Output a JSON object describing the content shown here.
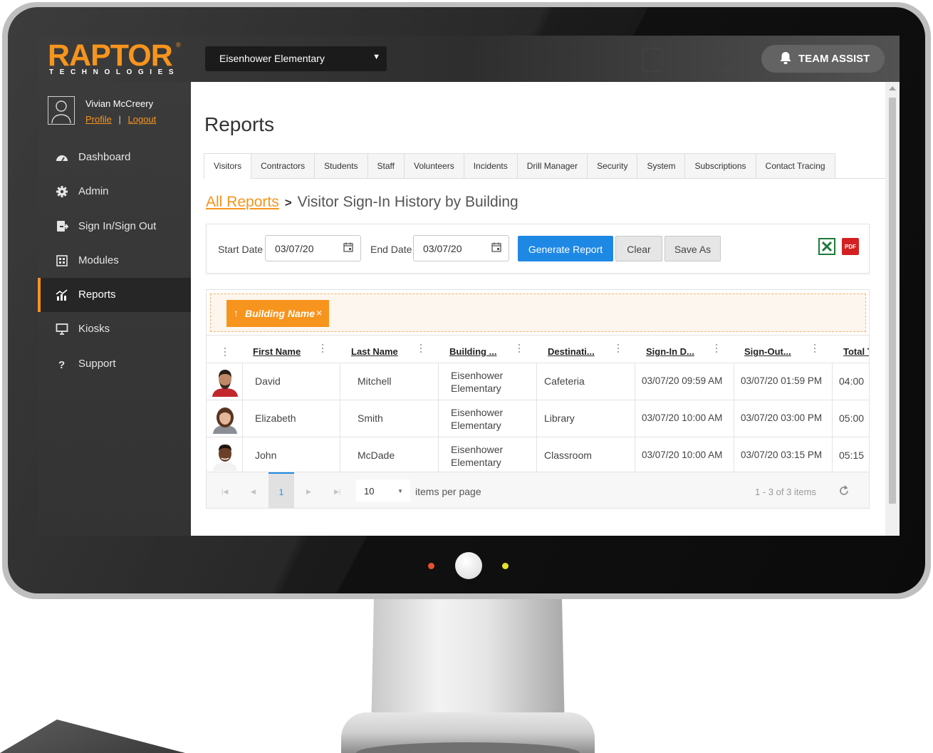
{
  "header": {
    "logo_main": "RAPTOR",
    "logo_sub": "TECHNOLOGIES",
    "school": "Eisenhower Elementary",
    "team_assist": "TEAM ASSIST"
  },
  "user": {
    "name": "Vivian McCreery",
    "profile_link": "Profile",
    "logout_link": "Logout",
    "separator": "|"
  },
  "sidebar": {
    "items": [
      {
        "label": "Dashboard",
        "icon": "dashboard-icon"
      },
      {
        "label": "Admin",
        "icon": "gear-icon"
      },
      {
        "label": "Sign In/Sign Out",
        "icon": "sign-in-icon"
      },
      {
        "label": "Modules",
        "icon": "modules-icon"
      },
      {
        "label": "Reports",
        "icon": "reports-icon",
        "active": true
      },
      {
        "label": "Kiosks",
        "icon": "monitor-icon"
      },
      {
        "label": "Support",
        "icon": "question-icon"
      }
    ]
  },
  "page": {
    "title": "Reports",
    "tabs": [
      "Visitors",
      "Contractors",
      "Students",
      "Staff",
      "Volunteers",
      "Incidents",
      "Drill Manager",
      "Security",
      "System",
      "Subscriptions",
      "Contact Tracing"
    ],
    "active_tab": "Visitors",
    "breadcrumb_link": "All Reports",
    "breadcrumb_current": "Visitor Sign-In History by Building"
  },
  "filters": {
    "start_label": "Start Date",
    "start_value": "03/07/20",
    "end_label": "End Date",
    "end_value": "03/07/20",
    "generate": "Generate Report",
    "clear": "Clear",
    "save_as": "Save As",
    "pdf_label": "PDF"
  },
  "grid": {
    "group_chip": "Building Name",
    "group_arrow": "↑",
    "group_remove": "×",
    "columns": [
      "First Name",
      "Last Name",
      "Building ...",
      "Destinati...",
      "Sign-In D...",
      "Sign-Out...",
      "Total T"
    ],
    "rows": [
      {
        "first": "David",
        "last": "Mitchell",
        "building": "Eisenhower Elementary",
        "destination": "Cafeteria",
        "sign_in": "03/07/20 09:59 AM",
        "sign_out": "03/07/20 01:59 PM",
        "total": "04:00"
      },
      {
        "first": "Elizabeth",
        "last": "Smith",
        "building": "Eisenhower Elementary",
        "destination": "Library",
        "sign_in": "03/07/20 10:00 AM",
        "sign_out": "03/07/20 03:00 PM",
        "total": "05:00"
      },
      {
        "first": "John",
        "last": "McDade",
        "building": "Eisenhower Elementary",
        "destination": "Classroom",
        "sign_in": "03/07/20 10:00 AM",
        "sign_out": "03/07/20 03:15 PM",
        "total": "05:15"
      }
    ]
  },
  "pager": {
    "current_page": "1",
    "page_size": "10",
    "items_per_page": "items per page",
    "info": "1 - 3 of 3 items"
  },
  "colors": {
    "brand_orange": "#f7941d",
    "primary_blue": "#1e88e5",
    "sidebar_bg": "#3b3b3b"
  }
}
